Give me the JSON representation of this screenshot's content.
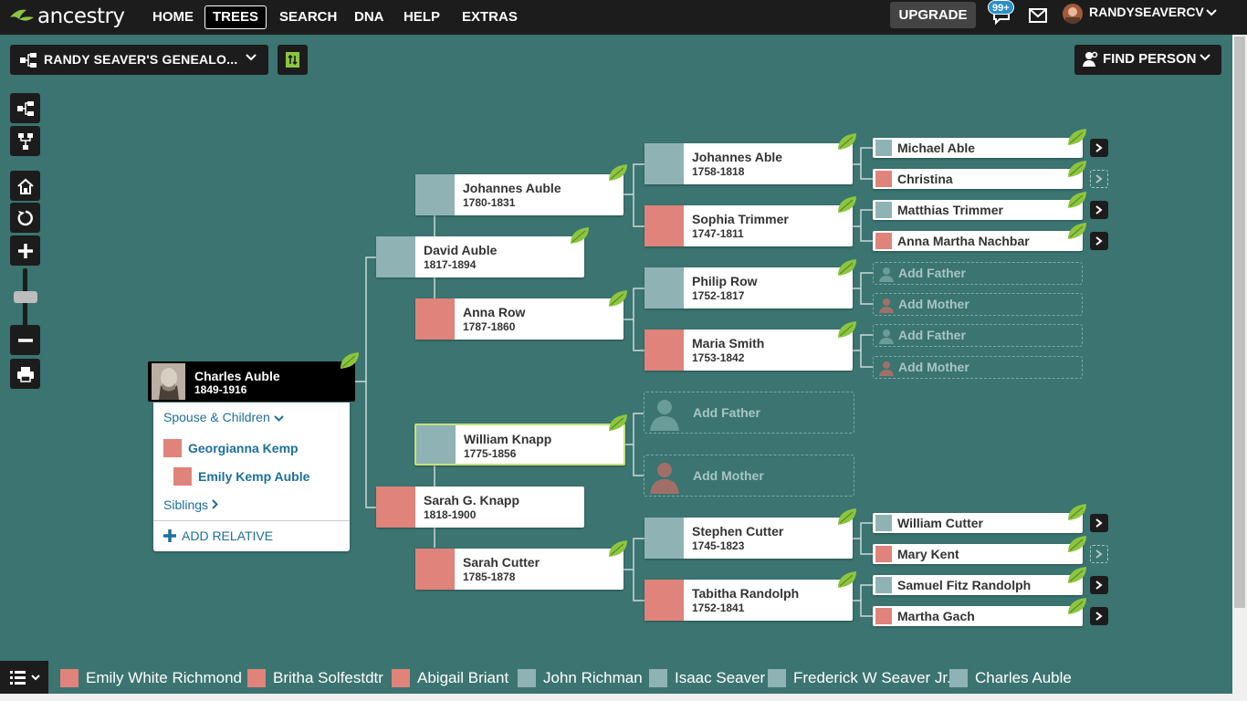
{
  "nav": {
    "logo": "ancestry",
    "links": [
      "HOME",
      "TREES",
      "SEARCH",
      "DNA",
      "HELP",
      "EXTRAS"
    ],
    "upgrade": "UPGRADE",
    "notif_count": "99+",
    "username": "RANDYSEAVERCV"
  },
  "toolbar": {
    "tree_name": "RANDY SEAVER'S GENEALO...",
    "find_person": "FIND PERSON"
  },
  "root": {
    "name": "Charles Auble",
    "dates": "1849-1916"
  },
  "family_panel": {
    "spouse_children": "Spouse & Children",
    "spouse": "Georgianna Kemp",
    "child": "Emily Kemp Auble",
    "siblings": "Siblings",
    "add_relative": "ADD RELATIVE"
  },
  "gen1": {
    "father": {
      "name": "David Auble",
      "dates": "1817-1894"
    },
    "mother": {
      "name": "Sarah G. Knapp",
      "dates": "1818-1900"
    }
  },
  "gen2": {
    "p1": {
      "name": "Johannes Auble",
      "dates": "1780-1831"
    },
    "p2": {
      "name": "Anna Row",
      "dates": "1787-1860"
    },
    "p3": {
      "name": "William Knapp",
      "dates": "1775-1856"
    },
    "p4": {
      "name": "Sarah Cutter",
      "dates": "1785-1878"
    }
  },
  "gen3": {
    "p1": {
      "name": "Johannes Able",
      "dates": "1758-1818"
    },
    "p2": {
      "name": "Sophia Trimmer",
      "dates": "1747-1811"
    },
    "p3": {
      "name": "Philip Row",
      "dates": "1752-1817"
    },
    "p4": {
      "name": "Maria Smith",
      "dates": "1753-1842"
    },
    "add_father": "Add Father",
    "add_mother": "Add Mother",
    "p7": {
      "name": "Stephen Cutter",
      "dates": "1745-1823"
    },
    "p8": {
      "name": "Tabitha Randolph",
      "dates": "1752-1841"
    }
  },
  "gen4": {
    "p1": "Michael Able",
    "p2": "Christina",
    "p3": "Matthias Trimmer",
    "p4": "Anna Martha Nachbar",
    "add_father": "Add Father",
    "add_mother": "Add Mother",
    "p13": "William Cutter",
    "p14": "Mary Kent",
    "p15": "Samuel Fitz Randolph",
    "p16": "Martha Gach"
  },
  "recent": [
    "Emily White Richmond",
    "Britha Solfestdtr",
    "Abigail Briant",
    "John Richman",
    "Isaac Seaver",
    "Frederick W Seaver Jr.",
    "Charles Auble"
  ],
  "colors": {
    "background": "#3b7470",
    "male": "#8fb3b5",
    "female": "#e0837a",
    "leaf": "#8cc63f",
    "link": "#1d6f9e"
  }
}
